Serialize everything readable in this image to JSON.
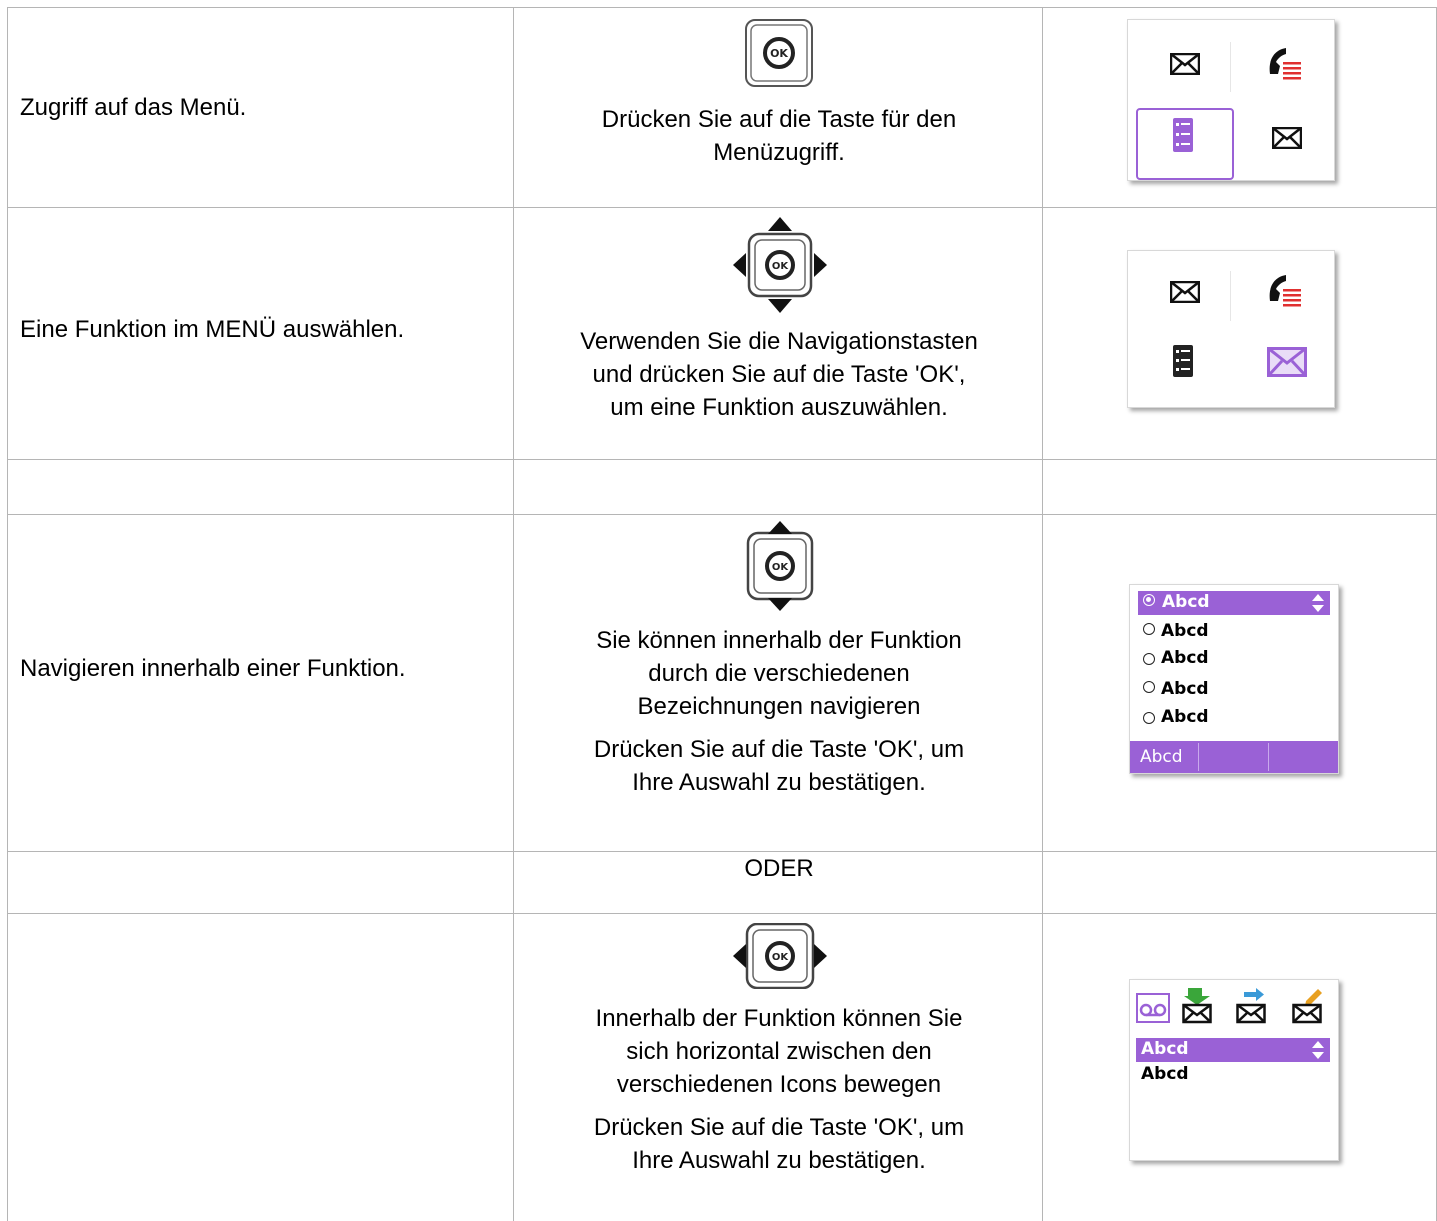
{
  "rows": [
    {
      "action": "Zugriff auf das Menü.",
      "instruction": [
        "Drücken Sie auf die Taste für den",
        "Menüzugriff."
      ]
    },
    {
      "action": "Eine Funktion im MENÜ auswählen.",
      "instruction": [
        "Verwenden Sie die Navigationstasten",
        "und drücken Sie auf die Taste 'OK',",
        "um eine Funktion auszuwählen."
      ]
    },
    {
      "action": "Navigieren innerhalb einer Funktion.",
      "instruction": [
        "Sie können innerhalb der Funktion",
        "durch die verschiedenen",
        "Bezeichnungen navigieren"
      ],
      "instruction2": [
        "Drücken Sie auf die Taste 'OK', um",
        "Ihre Auswahl zu bestätigen."
      ]
    },
    {
      "separator": "ODER"
    },
    {
      "instruction": [
        "Innerhalb der Funktion können Sie",
        "sich horizontal zwischen den",
        "verschiedenen Icons bewegen"
      ],
      "instruction2": [
        "Drücken Sie auf die Taste 'OK', um",
        "Ihre Auswahl zu bestätigen."
      ]
    }
  ],
  "key_label": "OK",
  "list_screen": {
    "items": [
      "Abcd",
      "Abcd",
      "Abcd",
      "Abcd",
      "Abcd"
    ],
    "softkey": "Abcd"
  },
  "icon_screen": {
    "items": [
      "Abcd",
      "Abcd"
    ]
  },
  "colors": {
    "accent": "#9a61d6",
    "grid": "#b5b5b5",
    "phone_red": "#e03030",
    "arrow_green": "#3aa63a",
    "arrow_blue": "#3a9ad8",
    "pencil_orange": "#e8a020"
  },
  "icons": [
    "ok-key-icon",
    "nav-4way-icon",
    "nav-updown-icon",
    "nav-leftright-icon",
    "envelope-icon",
    "call-log-icon",
    "contacts-list-icon",
    "voicemail-icon",
    "inbox-icon",
    "sent-icon",
    "draft-icon"
  ]
}
